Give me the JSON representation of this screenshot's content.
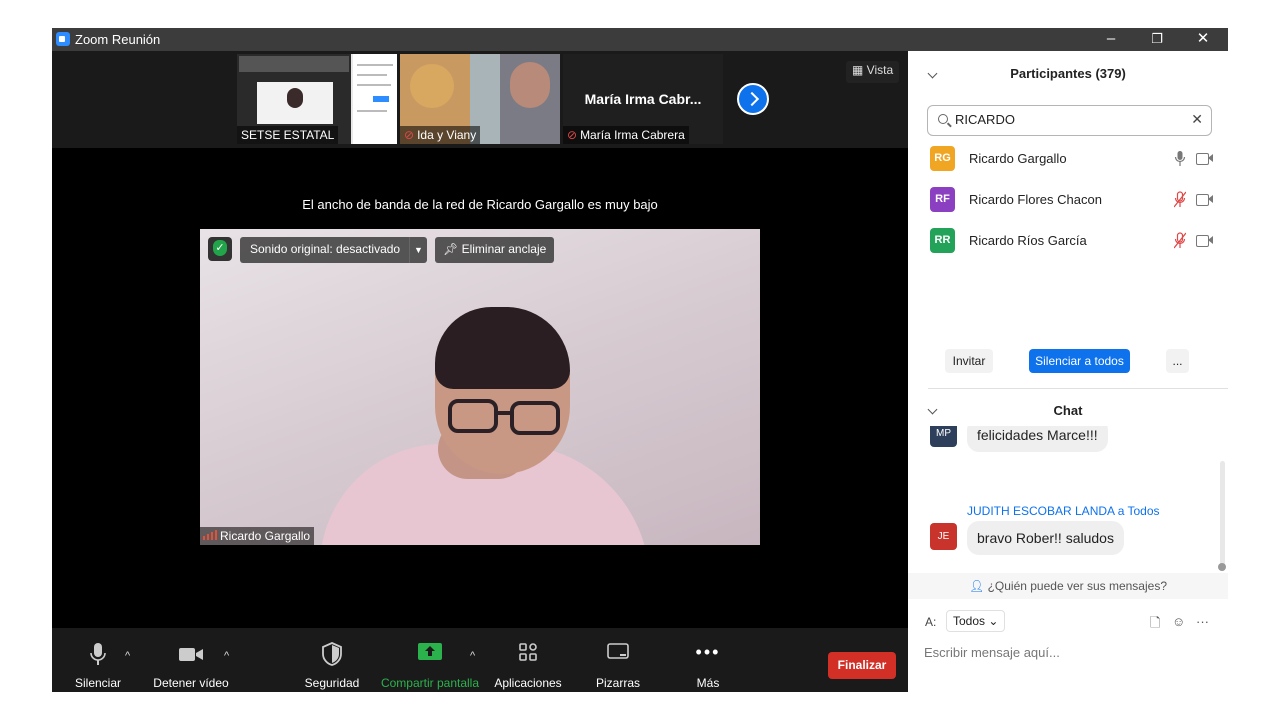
{
  "window": {
    "title": "Zoom Reunión",
    "minimize": "–",
    "restore": "❐",
    "close": "✕"
  },
  "strip": {
    "thumbs": [
      {
        "label": "SETSE ESTATAL",
        "muted": false
      },
      {
        "label": "Ida y Viany",
        "muted": true
      },
      {
        "label": "María Irma Cabrera",
        "title": "María Irma Cabr...",
        "muted": true
      }
    ],
    "view_label": "Vista",
    "next_icon": "chevron-right-icon"
  },
  "bandwidth_message": "El ancho de banda de la red de Ricardo Gargallo es muy bajo",
  "main_video": {
    "original_sound": "Sonido original: desactivado",
    "unpin": "Eliminar anclaje",
    "name": "Ricardo Gargallo"
  },
  "toolbar": {
    "mute": "Silenciar",
    "stop_video": "Detener vídeo",
    "security": "Seguridad",
    "share_screen": "Compartir pantalla",
    "apps": "Aplicaciones",
    "whiteboards": "Pizarras",
    "more": "Más",
    "end": "Finalizar",
    "share_color": "#2bb24c",
    "end_color": "#d22f27"
  },
  "participants": {
    "title": "Participantes (379)",
    "search_value": "RICARDO",
    "list": [
      {
        "initials": "RG",
        "name": "Ricardo Gargallo",
        "color": "#f0a623",
        "muted": false
      },
      {
        "initials": "RF",
        "name": "Ricardo Flores Chacon",
        "color": "#8b3fc1",
        "muted": true
      },
      {
        "initials": "RR",
        "name": "Ricardo Ríos García",
        "color": "#23a35a",
        "muted": true
      }
    ],
    "invite": "Invitar",
    "mute_all": "Silenciar a todos",
    "more": "..."
  },
  "chat": {
    "title": "Chat",
    "messages": [
      {
        "initials": "MP",
        "text": "felicidades Marce!!!",
        "color": "#2e3f5c"
      },
      {
        "initials": "JE",
        "sender": "JUDITH ESCOBAR LANDA",
        "to": "a Todos",
        "text": "bravo Rober!! saludos",
        "color": "#c8332b"
      }
    ],
    "who_can_see": "¿Quién puede ver sus mensajes?",
    "to_label": "A:",
    "to_value": "Todos",
    "placeholder": "Escribir mensaje aquí..."
  }
}
